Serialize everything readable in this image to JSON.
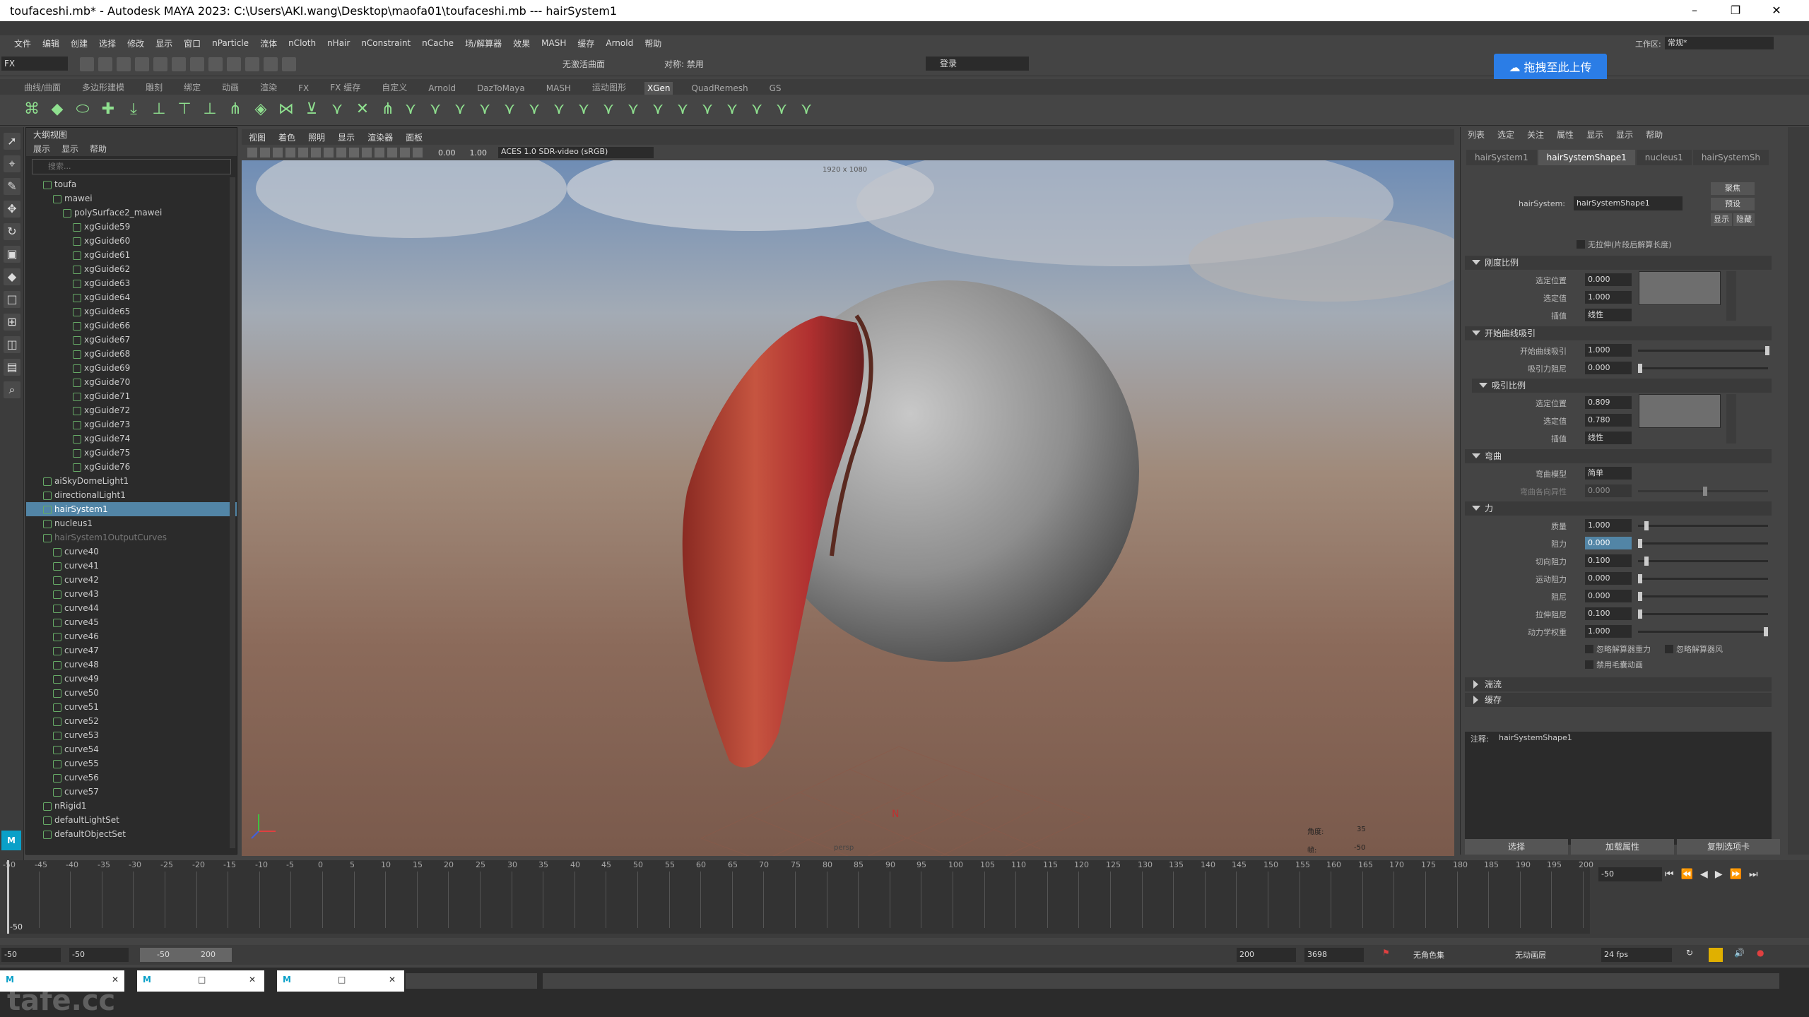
{
  "window": {
    "title": "toufaceshi.mb* - Autodesk MAYA 2023: C:\\Users\\AKI.wang\\Desktop\\maofa01\\toufaceshi.mb  ---  hairSystem1"
  },
  "menubar": [
    "文件",
    "编辑",
    "创建",
    "选择",
    "修改",
    "显示",
    "窗口",
    "nParticle",
    "流体",
    "nCloth",
    "nHair",
    "nConstraint",
    "nCache",
    "场/解算器",
    "效果",
    "MASH",
    "缓存",
    "Arnold",
    "帮助"
  ],
  "status": {
    "mode": "FX",
    "no_live": "无激活曲面",
    "symmetry": "对称: 禁用",
    "login": "登录",
    "upload": "拖拽至此上传",
    "workspace_label": "工作区:",
    "workspace": "常规*"
  },
  "shelf_tabs": [
    "曲线/曲面",
    "多边形建模",
    "雕刻",
    "绑定",
    "动画",
    "渲染",
    "FX",
    "FX 缓存",
    "自定义",
    "Arnold",
    "DazToMaya",
    "MASH",
    "运动图形",
    "XGen",
    "QuadRemesh",
    "GS"
  ],
  "shelf_active": "XGen",
  "outliner": {
    "title": "大纲视图",
    "menus": [
      "展示",
      "显示",
      "帮助"
    ],
    "search_placeholder": "搜索...",
    "items": [
      {
        "label": "toufa",
        "indent": 1
      },
      {
        "label": "mawei",
        "indent": 2
      },
      {
        "label": "polySurface2_mawei",
        "indent": 3
      },
      {
        "label": "xgGuide59",
        "indent": 4
      },
      {
        "label": "xgGuide60",
        "indent": 4
      },
      {
        "label": "xgGuide61",
        "indent": 4
      },
      {
        "label": "xgGuide62",
        "indent": 4
      },
      {
        "label": "xgGuide63",
        "indent": 4
      },
      {
        "label": "xgGuide64",
        "indent": 4
      },
      {
        "label": "xgGuide65",
        "indent": 4
      },
      {
        "label": "xgGuide66",
        "indent": 4
      },
      {
        "label": "xgGuide67",
        "indent": 4
      },
      {
        "label": "xgGuide68",
        "indent": 4
      },
      {
        "label": "xgGuide69",
        "indent": 4
      },
      {
        "label": "xgGuide70",
        "indent": 4
      },
      {
        "label": "xgGuide71",
        "indent": 4
      },
      {
        "label": "xgGuide72",
        "indent": 4
      },
      {
        "label": "xgGuide73",
        "indent": 4
      },
      {
        "label": "xgGuide74",
        "indent": 4
      },
      {
        "label": "xgGuide75",
        "indent": 4
      },
      {
        "label": "xgGuide76",
        "indent": 4
      },
      {
        "label": "aiSkyDomeLight1",
        "indent": 1
      },
      {
        "label": "directionalLight1",
        "indent": 1
      },
      {
        "label": "hairSystem1",
        "indent": 1,
        "selected": true
      },
      {
        "label": "nucleus1",
        "indent": 1
      },
      {
        "label": "hairSystem1OutputCurves",
        "indent": 1,
        "dim": true
      },
      {
        "label": "curve40",
        "indent": 2
      },
      {
        "label": "curve41",
        "indent": 2
      },
      {
        "label": "curve42",
        "indent": 2
      },
      {
        "label": "curve43",
        "indent": 2
      },
      {
        "label": "curve44",
        "indent": 2
      },
      {
        "label": "curve45",
        "indent": 2
      },
      {
        "label": "curve46",
        "indent": 2
      },
      {
        "label": "curve47",
        "indent": 2
      },
      {
        "label": "curve48",
        "indent": 2
      },
      {
        "label": "curve49",
        "indent": 2
      },
      {
        "label": "curve50",
        "indent": 2
      },
      {
        "label": "curve51",
        "indent": 2
      },
      {
        "label": "curve52",
        "indent": 2
      },
      {
        "label": "curve53",
        "indent": 2
      },
      {
        "label": "curve54",
        "indent": 2
      },
      {
        "label": "curve55",
        "indent": 2
      },
      {
        "label": "curve56",
        "indent": 2
      },
      {
        "label": "curve57",
        "indent": 2
      },
      {
        "label": "nRigid1",
        "indent": 1
      },
      {
        "label": "defaultLightSet",
        "indent": 1
      },
      {
        "label": "defaultObjectSet",
        "indent": 1
      }
    ]
  },
  "viewport": {
    "menus": [
      "视图",
      "着色",
      "照明",
      "显示",
      "渲染器",
      "面板"
    ],
    "exposure": "0.00",
    "gamma": "1.00",
    "colorspace": "ACES 1.0 SDR-video (sRGB)",
    "resolution": "1920 x 1080",
    "camera": "persp",
    "hud_label1": "角度:",
    "hud_val1": "35",
    "hud_label2": "帧:",
    "hud_val2": "-50"
  },
  "attr": {
    "menus": [
      "列表",
      "选定",
      "关注",
      "属性",
      "显示",
      "显示",
      "帮助"
    ],
    "tabs": [
      "hairSystem1",
      "hairSystemShape1",
      "nucleus1",
      "hairSystemSh"
    ],
    "active_tab": 1,
    "node_label": "hairSystem:",
    "node_value": "hairSystemShape1",
    "btn_focus": "聚焦",
    "btn_preset": "预设",
    "btn_show": "显示",
    "btn_hide": "隐藏",
    "no_stretch": "无拉伸(片段后解算长度)",
    "sec1": "刚度比例",
    "sec1_f1_label": "选定位置",
    "sec1_f1": "0.000",
    "sec1_f2_label": "选定值",
    "sec1_f2": "1.000",
    "sec1_f3_label": "插值",
    "sec1_f3": "线性",
    "sec2": "开始曲线吸引",
    "sec2_f1_label": "开始曲线吸引",
    "sec2_f1": "1.000",
    "sec2_f2_label": "吸引力阻尼",
    "sec2_f2": "0.000",
    "sec3": "吸引比例",
    "sec3_f1_label": "选定位置",
    "sec3_f1": "0.809",
    "sec3_f2_label": "选定值",
    "sec3_f2": "0.780",
    "sec3_f3_label": "插值",
    "sec3_f3": "线性",
    "sec4": "弯曲",
    "sec4_f1_label": "弯曲模型",
    "sec4_f1": "简单",
    "sec4_f2_label": "弯曲各向异性",
    "sec4_f2": "0.000",
    "sec5": "力",
    "forces": [
      {
        "label": "质量",
        "value": "1.000",
        "level": 0.05
      },
      {
        "label": "阻力",
        "value": "0.000",
        "level": 0.0,
        "hi": true
      },
      {
        "label": "切向阻力",
        "value": "0.100",
        "level": 0.05
      },
      {
        "label": "运动阻力",
        "value": "0.000",
        "level": 0.0
      },
      {
        "label": "阻尼",
        "value": "0.000",
        "level": 0.0
      },
      {
        "label": "拉伸阻尼",
        "value": "0.100",
        "level": 0.0
      },
      {
        "label": "动力学权重",
        "value": "1.000",
        "level": 1.0
      }
    ],
    "cb1": "忽略解算器重力",
    "cb2": "忽略解算器风",
    "cb3": "禁用毛囊动画",
    "sec6": "湍流",
    "sec7": "缓存",
    "notes_label": "注释:",
    "notes_value": "hairSystemShape1",
    "btn_select": "选择",
    "btn_load": "加载属性",
    "btn_copy": "复制选项卡"
  },
  "timeline": {
    "ticks": [
      "-50",
      "-45",
      "-40",
      "-35",
      "-30",
      "-25",
      "-20",
      "-15",
      "-10",
      "-5",
      "0",
      "5",
      "10",
      "15",
      "20",
      "25",
      "30",
      "35",
      "40",
      "45",
      "50",
      "55",
      "60",
      "65",
      "70",
      "75",
      "80",
      "85",
      "90",
      "95",
      "100",
      "105",
      "110",
      "115",
      "120",
      "125",
      "130",
      "135",
      "140",
      "145",
      "150",
      "155",
      "160",
      "165",
      "170",
      "175",
      "180",
      "185",
      "190",
      "195",
      "200"
    ],
    "current": "-50",
    "current_field": "-50"
  },
  "range": {
    "start": "-50",
    "start2": "-50",
    "range_start": "-50",
    "range_end": "200",
    "end": "200",
    "end2": "3698",
    "charset": "无角色集",
    "anim_layer": "无动画层",
    "fps": "24 fps"
  },
  "watermark": "tafe.cc"
}
